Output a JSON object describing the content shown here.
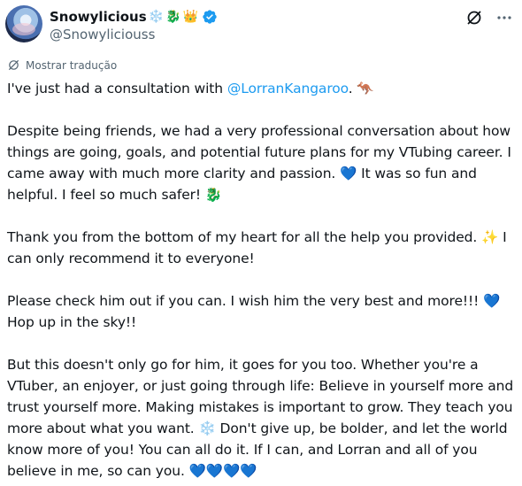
{
  "author": {
    "display_name": "Snowylicious",
    "name_emojis": [
      "❄️",
      "🐉",
      "👑"
    ],
    "handle": "@Snowyliciouss",
    "verified": true
  },
  "translate_label": "Mostrar tradução",
  "tweet": {
    "line1_pre": "I've just had a consultation with ",
    "mention": "@LorranKangaroo",
    "line1_post": ". 🦘",
    "p2": "Despite being friends, we had a very professional conversation about how things are going, goals, and potential future plans for my VTubing career. I came away with much more clarity and passion. 💙 It was so fun and helpful. I feel so much safer! 🐉",
    "p3": "Thank you from the bottom of my heart for all the help you provided. ✨ I can only recommend it to everyone!",
    "p4": "Please check him out if you can. I wish him the very best and more!!! 💙 Hop up in the sky!!",
    "p5": "But this doesn't only go for him, it goes for you too. Whether you're a VTuber, an enjoyer, or just going through life: Believe in yourself more and trust yourself more. Making mistakes is important to grow. They teach you more about what you want. ❄️ Don't give up, be bolder, and let the world know more of you! You can all do it. If I can, and Lorran and all of you believe in me, so can you. 💙💙💙💙"
  },
  "colors": {
    "link": "#1d9bf0",
    "secondary_text": "#536471",
    "primary_text": "#0f1419",
    "verified_badge": "#1d9bf0"
  },
  "icons": {
    "verified": "verified-badge-icon",
    "grok": "grok-icon",
    "more": "more-dots-icon",
    "translate": "translate-icon"
  }
}
